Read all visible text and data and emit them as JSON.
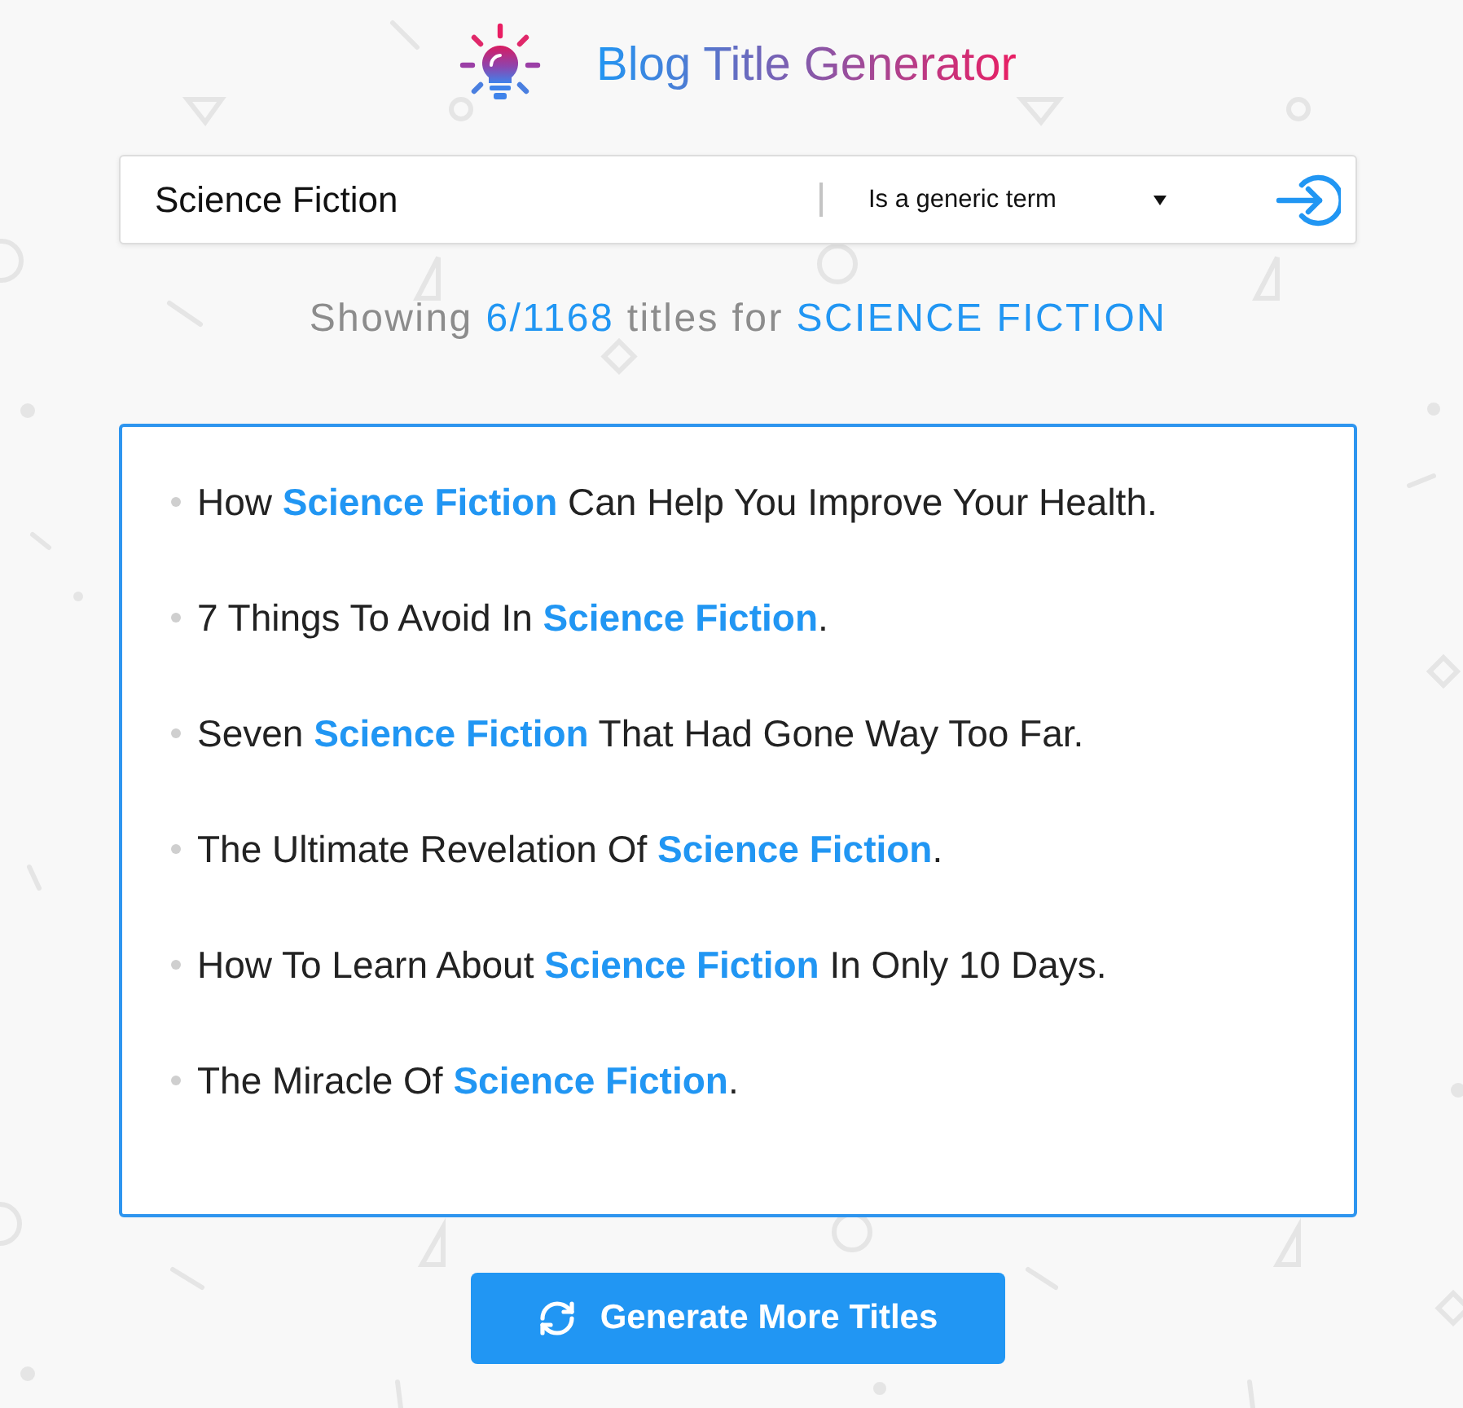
{
  "header": {
    "title": "Blog Title Generator"
  },
  "search": {
    "value": "Science Fiction",
    "term_type": "Is a generic term"
  },
  "summary": {
    "prefix": "Showing",
    "count": "6/1168",
    "middle": "titles for",
    "keyword": "SCIENCE FICTION"
  },
  "titles": [
    "How **Science Fiction** Can Help You Improve Your Health.",
    "7 Things To Avoid In **Science Fiction**.",
    "Seven **Science Fiction** That Had Gone Way Too Far.",
    "The Ultimate Revelation Of **Science Fiction**.",
    "How To Learn About **Science Fiction** In Only 10 Days.",
    "The Miracle Of **Science Fiction**."
  ],
  "button": {
    "label": "Generate More Titles"
  }
}
